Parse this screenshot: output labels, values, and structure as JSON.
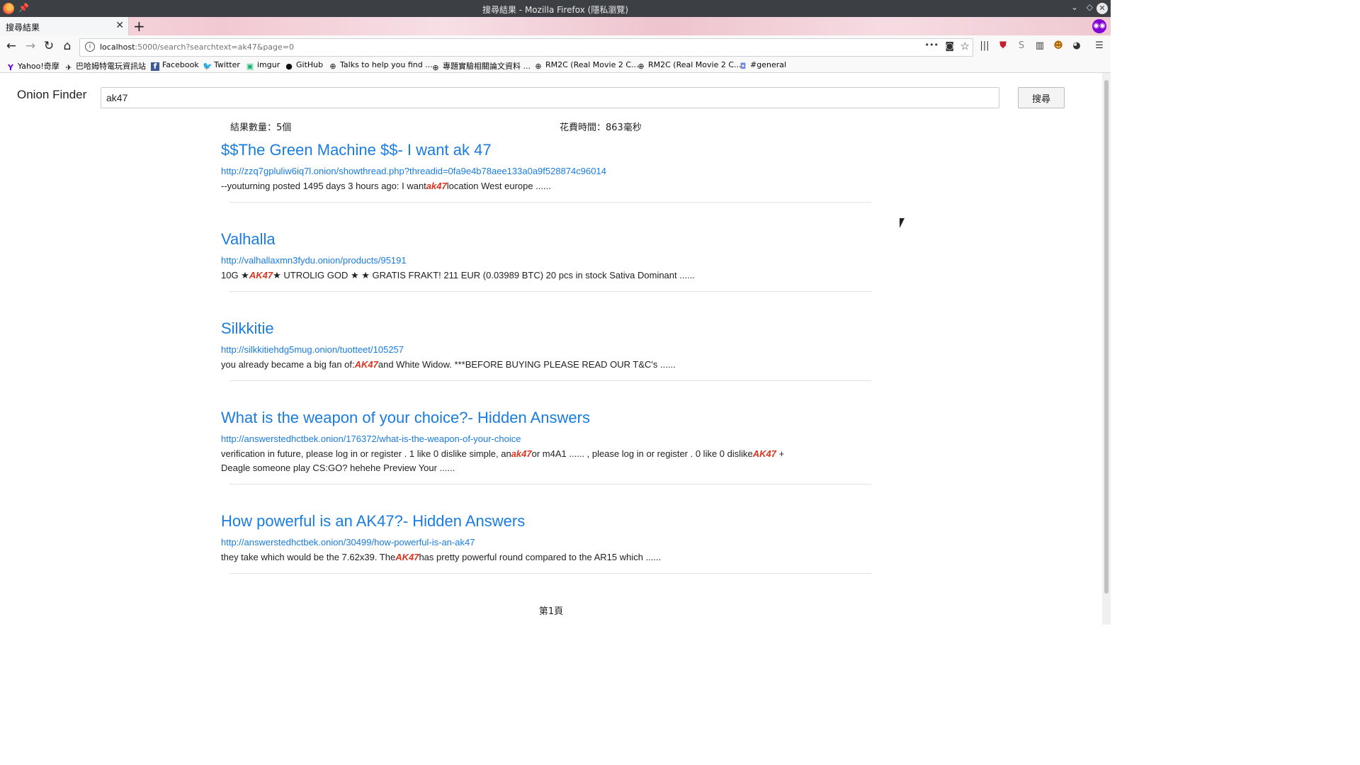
{
  "window": {
    "title": "搜尋結果 - Mozilla Firefox (隱私瀏覽)",
    "minimize_glyph": "⌄",
    "restore_glyph": "◇",
    "close_glyph": "✕",
    "pin_glyph": "📌"
  },
  "tab": {
    "title": "搜尋結果",
    "close_glyph": "✕",
    "new_tab_glyph": "+"
  },
  "nav": {
    "back_glyph": "←",
    "forward_glyph": "→",
    "reload_glyph": "↻",
    "home_glyph": "⌂",
    "url_host": "localhost",
    "url_rest": ":5000/search?searchtext=ak47&page=0",
    "more_glyph": "•••",
    "pocket_glyph": "◙",
    "star_glyph": "☆",
    "menu_glyph": "☰"
  },
  "bookmarks": [
    {
      "label": "Yahoo!奇摩",
      "icon": "yahoo-icon",
      "glyph": "Y"
    },
    {
      "label": "巴哈姆特電玩資訊站",
      "icon": "bahamut-icon",
      "glyph": "✈"
    },
    {
      "label": "Facebook",
      "icon": "facebook-icon",
      "glyph": "f"
    },
    {
      "label": "Twitter",
      "icon": "twitter-icon",
      "glyph": "🐦"
    },
    {
      "label": "imgur",
      "icon": "imgur-icon",
      "glyph": "▣"
    },
    {
      "label": "GitHub",
      "icon": "github-icon",
      "glyph": "●"
    },
    {
      "label": "Talks to help you find ...",
      "icon": "globe-icon",
      "glyph": "⊕"
    },
    {
      "label": "專題實驗相關論文資料 ...",
      "icon": "globe-icon",
      "glyph": "⊕"
    },
    {
      "label": "RM2C (Real Movie 2 C...",
      "icon": "globe-icon",
      "glyph": "⊕"
    },
    {
      "label": "RM2C (Real Movie 2 C...",
      "icon": "globe-icon",
      "glyph": "⊕"
    },
    {
      "label": "#general",
      "icon": "discord-icon",
      "glyph": "◘"
    }
  ],
  "page": {
    "brand": "Onion Finder",
    "search_value": "ak47",
    "search_button": "搜尋",
    "result_count": "結果數量：5個",
    "elapsed": "花費時間：863毫秒",
    "pager": "第1頁"
  },
  "results": [
    {
      "title": "$$The Green Machine $$- I want ak 47",
      "url": "http://zzq7gpluliw6iq7l.onion/showthread.php?threadid=0fa9e4b78aee133a0a9f528874c96014",
      "snippet": [
        {
          "t": "--youturning posted 1495 days 3 hours ago: I want"
        },
        {
          "t": "ak47",
          "hl": true
        },
        {
          "t": "location West europe ......"
        }
      ]
    },
    {
      "title": "Valhalla",
      "url": "http://valhallaxmn3fydu.onion/products/95191",
      "snippet": [
        {
          "t": "10G ★"
        },
        {
          "t": "AK47",
          "hl": true
        },
        {
          "t": "★ UTROLIG GOD ★ ★ GRATIS FRAKT! 211 EUR (0.03989 BTC) 20 pcs in stock Sativa Dominant ......"
        }
      ]
    },
    {
      "title": "Silkkitie",
      "url": "http://silkkitiehdg5mug.onion/tuotteet/105257",
      "snippet": [
        {
          "t": "you already became a big fan of:"
        },
        {
          "t": "AK47",
          "hl": true
        },
        {
          "t": "and White Widow. ***BEFORE BUYING PLEASE READ OUR T&C's ......"
        }
      ]
    },
    {
      "title": "What is the weapon of your choice?- Hidden Answers",
      "url": "http://answerstedhctbek.onion/176372/what-is-the-weapon-of-your-choice",
      "snippet": [
        {
          "t": "verification in future, please log in or register . 1 like 0 dislike simple, an"
        },
        {
          "t": "ak47",
          "hl": true
        },
        {
          "t": "or m4A1 ...... , please log in or register . 0 like 0 dislike"
        },
        {
          "t": "AK47",
          "hl": true
        },
        {
          "t": " + Deagle someone play CS:GO? hehehe Preview Your ......"
        }
      ]
    },
    {
      "title": "How powerful is an AK47?- Hidden Answers",
      "url": "http://answerstedhctbek.onion/30499/how-powerful-is-an-ak47",
      "snippet": [
        {
          "t": "they take which would be the 7.62x39. The"
        },
        {
          "t": "AK47",
          "hl": true
        },
        {
          "t": "has pretty powerful round compared to the AR15 which ......"
        }
      ]
    }
  ]
}
